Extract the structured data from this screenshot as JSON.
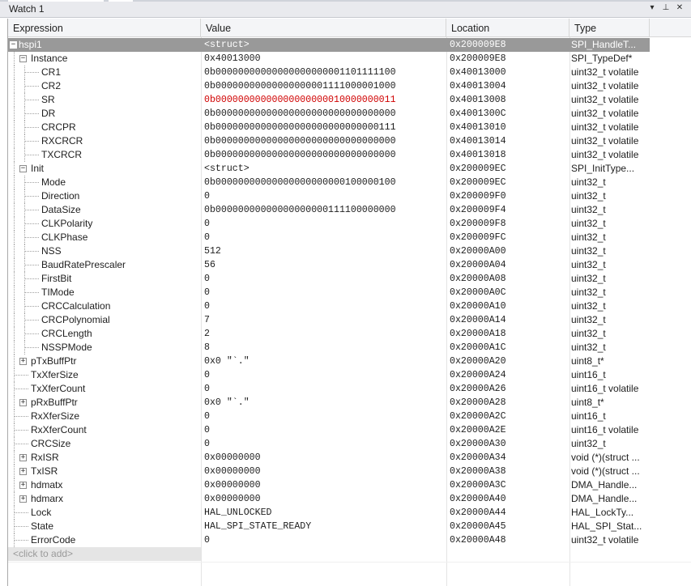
{
  "window": {
    "title": "Watch 1",
    "controls": {
      "dropdown": "▾",
      "pin": "⊥",
      "close": "✕"
    }
  },
  "columns": {
    "expression": "Expression",
    "value": "Value",
    "location": "Location",
    "type": "Type"
  },
  "rows": [
    {
      "expr": "hspi1",
      "value": "<struct>",
      "loc": "0x200009E8",
      "type": "SPI_HandleT...",
      "level": 0,
      "expander": "minus",
      "selected": true
    },
    {
      "expr": "Instance",
      "value": "0x40013000",
      "loc": "0x200009E8",
      "type": "SPI_TypeDef*",
      "level": 1,
      "expander": "minus"
    },
    {
      "expr": "CR1",
      "value": "0b00000000000000000000001101111100",
      "loc": "0x40013000",
      "type": "uint32_t volatile",
      "level": 2
    },
    {
      "expr": "CR2",
      "value": "0b00000000000000000001111000001000",
      "loc": "0x40013004",
      "type": "uint32_t volatile",
      "level": 2
    },
    {
      "expr": "SR",
      "value": "0b00000000000000000000010000000011",
      "loc": "0x40013008",
      "type": "uint32_t volatile",
      "level": 2,
      "changed": true
    },
    {
      "expr": "DR",
      "value": "0b00000000000000000000000000000000",
      "loc": "0x4001300C",
      "type": "uint32_t volatile",
      "level": 2
    },
    {
      "expr": "CRCPR",
      "value": "0b00000000000000000000000000000111",
      "loc": "0x40013010",
      "type": "uint32_t volatile",
      "level": 2
    },
    {
      "expr": "RXCRCR",
      "value": "0b00000000000000000000000000000000",
      "loc": "0x40013014",
      "type": "uint32_t volatile",
      "level": 2
    },
    {
      "expr": "TXCRCR",
      "value": "0b00000000000000000000000000000000",
      "loc": "0x40013018",
      "type": "uint32_t volatile",
      "level": 2
    },
    {
      "expr": "Init",
      "value": "<struct>",
      "loc": "0x200009EC",
      "type": "SPI_InitType...",
      "level": 1,
      "expander": "minus"
    },
    {
      "expr": "Mode",
      "value": "0b00000000000000000000000100000100",
      "loc": "0x200009EC",
      "type": "uint32_t",
      "level": 2
    },
    {
      "expr": "Direction",
      "value": "0",
      "loc": "0x200009F0",
      "type": "uint32_t",
      "level": 2
    },
    {
      "expr": "DataSize",
      "value": "0b00000000000000000000111100000000",
      "loc": "0x200009F4",
      "type": "uint32_t",
      "level": 2
    },
    {
      "expr": "CLKPolarity",
      "value": "0",
      "loc": "0x200009F8",
      "type": "uint32_t",
      "level": 2
    },
    {
      "expr": "CLKPhase",
      "value": "0",
      "loc": "0x200009FC",
      "type": "uint32_t",
      "level": 2
    },
    {
      "expr": "NSS",
      "value": "512",
      "loc": "0x20000A00",
      "type": "uint32_t",
      "level": 2
    },
    {
      "expr": "BaudRatePrescaler",
      "value": "56",
      "loc": "0x20000A04",
      "type": "uint32_t",
      "level": 2
    },
    {
      "expr": "FirstBit",
      "value": "0",
      "loc": "0x20000A08",
      "type": "uint32_t",
      "level": 2
    },
    {
      "expr": "TIMode",
      "value": "0",
      "loc": "0x20000A0C",
      "type": "uint32_t",
      "level": 2
    },
    {
      "expr": "CRCCalculation",
      "value": "0",
      "loc": "0x20000A10",
      "type": "uint32_t",
      "level": 2
    },
    {
      "expr": "CRCPolynomial",
      "value": "7",
      "loc": "0x20000A14",
      "type": "uint32_t",
      "level": 2
    },
    {
      "expr": "CRCLength",
      "value": "2",
      "loc": "0x20000A18",
      "type": "uint32_t",
      "level": 2
    },
    {
      "expr": "NSSPMode",
      "value": "8",
      "loc": "0x20000A1C",
      "type": "uint32_t",
      "level": 2
    },
    {
      "expr": "pTxBuffPtr",
      "value": "0x0 \"`.\"",
      "loc": "0x20000A20",
      "type": "uint8_t*",
      "level": 1,
      "expander": "plus"
    },
    {
      "expr": "TxXferSize",
      "value": "0",
      "loc": "0x20000A24",
      "type": "uint16_t",
      "level": 1
    },
    {
      "expr": "TxXferCount",
      "value": "0",
      "loc": "0x20000A26",
      "type": "uint16_t volatile",
      "level": 1
    },
    {
      "expr": "pRxBuffPtr",
      "value": "0x0 \"`.\"",
      "loc": "0x20000A28",
      "type": "uint8_t*",
      "level": 1,
      "expander": "plus"
    },
    {
      "expr": "RxXferSize",
      "value": "0",
      "loc": "0x20000A2C",
      "type": "uint16_t",
      "level": 1
    },
    {
      "expr": "RxXferCount",
      "value": "0",
      "loc": "0x20000A2E",
      "type": "uint16_t volatile",
      "level": 1
    },
    {
      "expr": "CRCSize",
      "value": "0",
      "loc": "0x20000A30",
      "type": "uint32_t",
      "level": 1
    },
    {
      "expr": "RxISR",
      "value": "0x00000000",
      "loc": "0x20000A34",
      "type": "void (*)(struct ...",
      "level": 1,
      "expander": "plus"
    },
    {
      "expr": "TxISR",
      "value": "0x00000000",
      "loc": "0x20000A38",
      "type": "void (*)(struct ...",
      "level": 1,
      "expander": "plus"
    },
    {
      "expr": "hdmatx",
      "value": "0x00000000",
      "loc": "0x20000A3C",
      "type": "DMA_Handle...",
      "level": 1,
      "expander": "plus"
    },
    {
      "expr": "hdmarx",
      "value": "0x00000000",
      "loc": "0x20000A40",
      "type": "DMA_Handle...",
      "level": 1,
      "expander": "plus"
    },
    {
      "expr": "Lock",
      "value": "HAL_UNLOCKED",
      "loc": "0x20000A44",
      "type": "HAL_LockTy...",
      "level": 1
    },
    {
      "expr": "State",
      "value": "HAL_SPI_STATE_READY",
      "loc": "0x20000A45",
      "type": "HAL_SPI_Stat...",
      "level": 1
    },
    {
      "expr": "ErrorCode",
      "value": "0",
      "loc": "0x20000A48",
      "type": "uint32_t volatile",
      "level": 1
    }
  ],
  "add_placeholder": "<click to add>",
  "colors": {
    "changed_value": "#d00000",
    "selected_row": "#999999",
    "header_bg": "#f4f5f7",
    "titlebar_bg": "#e9eaee"
  }
}
